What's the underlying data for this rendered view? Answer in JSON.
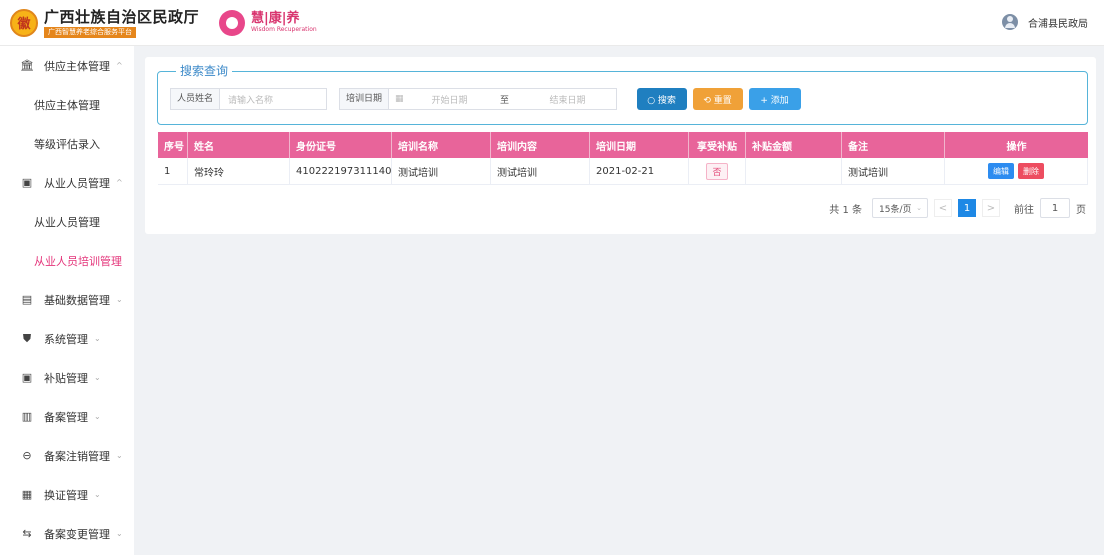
{
  "header": {
    "org_title": "广西壮族自治区民政厅",
    "org_subtitle": "广西智慧养老综合服务平台",
    "emblem_text": "徽",
    "wisdom_cn": "慧|康|养",
    "wisdom_en": "Wisdom Recuperation",
    "user_name": "合浦县民政局"
  },
  "sidebar": {
    "groups": [
      {
        "label": "供应主体管理",
        "icon": "bank-icon",
        "glyph": "🏛",
        "arrow": "^"
      },
      {
        "label": "从业人员管理",
        "icon": "id-card-icon",
        "glyph": "▣",
        "arrow": "^"
      },
      {
        "label": "基础数据管理",
        "icon": "database-icon",
        "glyph": "▤",
        "arrow": "⌄"
      },
      {
        "label": "系统管理",
        "icon": "shield-icon",
        "glyph": "⛊",
        "arrow": "⌄"
      },
      {
        "label": "补贴管理",
        "icon": "wallet-icon",
        "glyph": "▣",
        "arrow": "⌄"
      },
      {
        "label": "备案管理",
        "icon": "file-icon",
        "glyph": "▥",
        "arrow": "⌄"
      },
      {
        "label": "备案注销管理",
        "icon": "cancel-circle-icon",
        "glyph": "⊖",
        "arrow": "⌄"
      },
      {
        "label": "换证管理",
        "icon": "certificate-icon",
        "glyph": "▦",
        "arrow": "⌄"
      },
      {
        "label": "备案变更管理",
        "icon": "change-icon",
        "glyph": "⇆",
        "arrow": "⌄"
      }
    ],
    "sub_items": [
      {
        "label": "供应主体管理"
      },
      {
        "label": "等级评估录入"
      },
      {
        "label": "从业人员管理"
      },
      {
        "label": "从业人员培训管理"
      }
    ]
  },
  "search": {
    "legend": "搜索查询",
    "name_label": "人员姓名",
    "name_placeholder": "请输入名称",
    "date_label": "培训日期",
    "date_start": "开始日期",
    "date_sep": "至",
    "date_end": "结束日期",
    "btn_search": "○ 搜索",
    "btn_reset": "⟲ 重置",
    "btn_add": "+ 添加"
  },
  "table": {
    "headers": [
      "序号",
      "姓名",
      "身份证号",
      "培训名称",
      "培训内容",
      "培训日期",
      "享受补贴",
      "补贴金额",
      "备注",
      "操作"
    ],
    "rows": [
      {
        "index": "1",
        "name": "常玲玲",
        "id_number": "410222197311140...",
        "training_name": "测试培训",
        "training_content": "测试培训",
        "training_date": "2021-02-21",
        "subsidy": "否",
        "amount": "",
        "remark": "测试培训",
        "edit_label": "编辑",
        "delete_label": "删除"
      }
    ]
  },
  "pagination": {
    "total": "共 1 条",
    "page_size": "15条/页",
    "prev": "<",
    "current_page": "1",
    "next": ">",
    "goto_label": "前往",
    "goto_value": "1",
    "goto_suffix": "页"
  },
  "colors": {
    "accent_pink": "#e8649a",
    "active_menu": "#e4347a",
    "primary_blue": "#1f7fc0",
    "warning_orange": "#f0a138"
  }
}
